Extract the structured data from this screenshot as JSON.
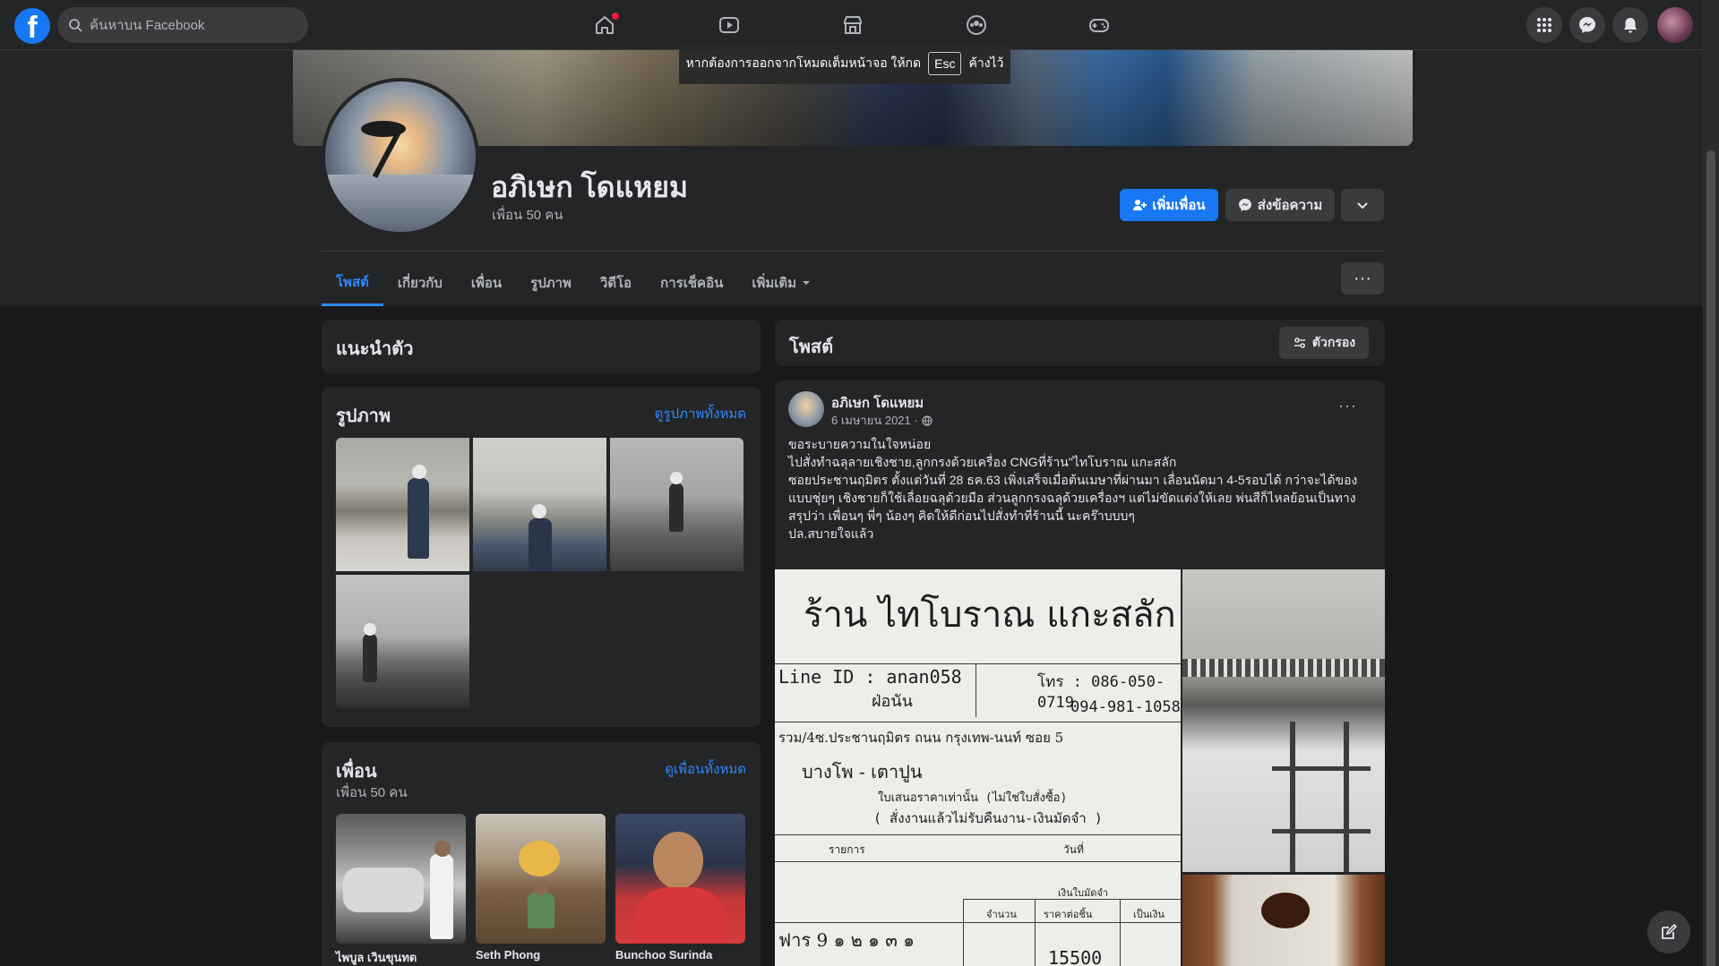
{
  "topnav": {
    "logo": "f",
    "search_placeholder": "ค้นหาบน Facebook",
    "icons": [
      "home-icon",
      "watch-icon",
      "marketplace-icon",
      "groups-icon",
      "gaming-icon"
    ],
    "right_icons": [
      "menu-grid-icon",
      "messenger-icon",
      "notifications-icon"
    ]
  },
  "toast": {
    "text_before": "หากต้องการออกจากโหมดเต็มหน้าจอ ให้กด",
    "key": "Esc",
    "text_after": "ค้างไว้"
  },
  "profile": {
    "name": "อภิเษก โดแหยม",
    "friends_count": "เพื่อน 50 คน",
    "add_friend_label": "เพิ่มเพื่อน",
    "message_label": "ส่งข้อความ"
  },
  "tabs": [
    {
      "label": "โพสต์",
      "active": true
    },
    {
      "label": "เกี่ยวกับ"
    },
    {
      "label": "เพื่อน"
    },
    {
      "label": "รูปภาพ"
    },
    {
      "label": "วิดีโอ"
    },
    {
      "label": "การเช็คอิน"
    },
    {
      "label": "เพิ่มเติม"
    }
  ],
  "intro": {
    "title": "แนะนำตัว"
  },
  "photos": {
    "title": "รูปภาพ",
    "see_all": "ดูรูปภาพทั้งหมด"
  },
  "friends": {
    "title": "เพื่อน",
    "count": "เพื่อน 50 คน",
    "see_all": "ดูเพื่อนทั้งหมด",
    "items": [
      {
        "name": "ไพบูล เวินขุนทด"
      },
      {
        "name": "Seth Phong"
      },
      {
        "name": "Bunchoo Surinda"
      }
    ]
  },
  "posts_header": {
    "title": "โพสต์",
    "filter_label": "ตัวกรอง"
  },
  "post": {
    "author": "อภิเษก โดแหยม",
    "date": "6 เมษายน 2021 ·",
    "lines": [
      "ขอระบายความในใจหน่อย",
      "ไปสั่งทำฉลุลายเชิงชาย,ลูกกรงด้วยเครื่อง CNGที่ร้าน\"ไทโบราณ แกะสลัก",
      "ซอยประชานฤมิตร ตั้งแต่วันที่ 28 ธค.63 เพิ่งเสร็จเมื่อต้นเมษาที่ผ่านมา เลื่อนนัดมา 4-5รอบได้ กว่าจะได้ของ แบบชุ่ยๆ เชิงชายก็ใช้เลื่อยฉลุด้วยมือ ส่วนลูกกรงฉลุด้วยเครื่องฯ แต่ไม่ขัดแต่งให้เลย พ่นสีก็ไหลย้อนเป็นทาง",
      "สรุปว่า เพื่อนๆ พี่ๆ น้องๆ คิดให้ดีก่อนไปสั่งทำที่ร้านนี้ นะคร๊าบบบๆ",
      "ปล.สบายใจแล้ว"
    ],
    "receipt": {
      "title": "ร้าน ไทโบราณ แกะสลัก",
      "line_id": "Line ID : anan058",
      "tel_label": "โทร : 086-050-0719",
      "tel2": "094-981-1058",
      "handwriting1": "ฝ่อนัน",
      "address_hint": "รวม/4ซ.ประชานฤมิตร ถนน กรุงเทพ-นนท์ ซอย 5",
      "handwriting2": "บางโพ - เตาปูน",
      "quote_note": "ใบเสนอราคาเท่านั้น (ไม่ใช่ใบสั่งซื้อ)",
      "order_note": "( สั่งงานแล้วไม่รับคืนงาน-เงินมัดจำ )",
      "list_label": "รายการ",
      "date_label": "วันที่",
      "deposit_label": "เงินใบมัดจำ",
      "qty_label": "จำนวน",
      "unit_label": "ราคาต่อชิ้น",
      "total_label": "เป็นเงิน",
      "handwriting3": "ฟาร 9 ๑ ๒ ๑ ๓ ๑",
      "amount": "15500"
    }
  }
}
